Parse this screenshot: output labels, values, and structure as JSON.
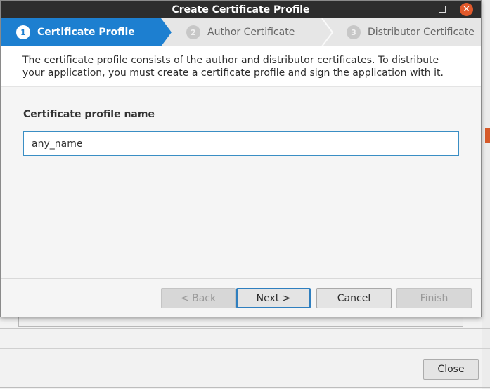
{
  "background": {
    "close_label": "Close",
    "accent_orange": "#d65a2a"
  },
  "dialog": {
    "title": "Create Certificate Profile",
    "window_controls": {
      "minimize_icon": "square-icon",
      "close_icon": "close-x-icon",
      "close_glyph": "✕"
    },
    "steps": [
      {
        "number": "1",
        "label": "Certificate Profile",
        "active": true
      },
      {
        "number": "2",
        "label": "Author Certificate",
        "active": false
      },
      {
        "number": "3",
        "label": "Distributor Certificate",
        "active": false
      }
    ],
    "description": "The certificate profile consists of the author and distributor certificates. To distribute your application, you must create a certificate profile and sign the application with it.",
    "field_label": "Certificate profile name",
    "profile_name_value": "any_name",
    "buttons": {
      "back": "< Back",
      "next": "Next >",
      "cancel": "Cancel",
      "finish": "Finish"
    },
    "colors": {
      "active_step": "#1d7fd0",
      "title_bar": "#2d2d2d",
      "close_button": "#e25a2c",
      "focus_border": "#2f7fbf"
    }
  }
}
